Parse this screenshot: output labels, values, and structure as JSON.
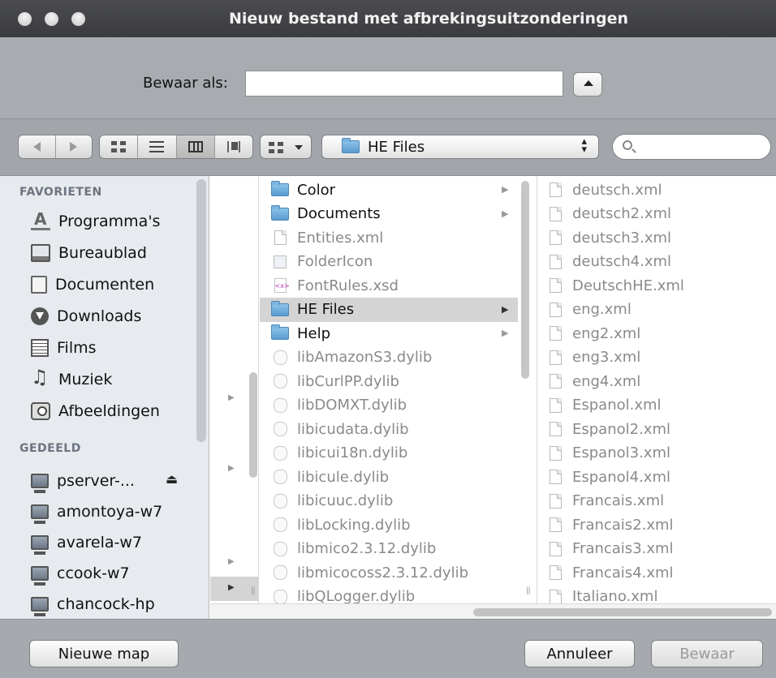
{
  "window": {
    "title": "Nieuw bestand met afbrekingsuitzonderingen"
  },
  "save": {
    "label": "Bewaar als:",
    "value": ""
  },
  "toolbar": {
    "location": "HE Files",
    "search_placeholder": ""
  },
  "sidebar": {
    "favorites_header": "FAVORIETEN",
    "favorites": [
      {
        "label": "Programma's",
        "icon": "applications-icon"
      },
      {
        "label": "Bureaublad",
        "icon": "desktop-icon"
      },
      {
        "label": "Documenten",
        "icon": "documents-icon"
      },
      {
        "label": "Downloads",
        "icon": "downloads-icon"
      },
      {
        "label": "Films",
        "icon": "movies-icon"
      },
      {
        "label": "Muziek",
        "icon": "music-icon"
      },
      {
        "label": "Afbeeldingen",
        "icon": "pictures-icon"
      }
    ],
    "shared_header": "GEDEELD",
    "shared": [
      {
        "label": "pserver-..."
      },
      {
        "label": "amontoya-w7"
      },
      {
        "label": "avarela-w7"
      },
      {
        "label": "ccook-w7"
      },
      {
        "label": "chancock-hp"
      }
    ]
  },
  "column1": {
    "items": [
      {
        "name": "Color",
        "type": "folder"
      },
      {
        "name": "Documents",
        "type": "folder"
      },
      {
        "name": "Entities.xml",
        "type": "file"
      },
      {
        "name": "FolderIcon",
        "type": "icon"
      },
      {
        "name": "FontRules.xsd",
        "type": "xsd"
      },
      {
        "name": "HE Files",
        "type": "folder",
        "selected": true
      },
      {
        "name": "Help",
        "type": "folder"
      },
      {
        "name": "libAmazonS3.dylib",
        "type": "lib"
      },
      {
        "name": "libCurlPP.dylib",
        "type": "lib"
      },
      {
        "name": "libDOMXT.dylib",
        "type": "lib"
      },
      {
        "name": "libicudata.dylib",
        "type": "lib"
      },
      {
        "name": "libicui18n.dylib",
        "type": "lib"
      },
      {
        "name": "libicule.dylib",
        "type": "lib"
      },
      {
        "name": "libicuuc.dylib",
        "type": "lib"
      },
      {
        "name": "libLocking.dylib",
        "type": "lib"
      },
      {
        "name": "libmico2.3.12.dylib",
        "type": "lib"
      },
      {
        "name": "libmicocoss2.3.12.dylib",
        "type": "lib"
      },
      {
        "name": "libQLogger.dylib",
        "type": "lib"
      }
    ]
  },
  "column2": {
    "items": [
      "deutsch.xml",
      "deutsch2.xml",
      "deutsch3.xml",
      "deutsch4.xml",
      "DeutschHE.xml",
      "eng.xml",
      "eng2.xml",
      "eng3.xml",
      "eng4.xml",
      "Espanol.xml",
      "Espanol2.xml",
      "Espanol3.xml",
      "Espanol4.xml",
      "Francais.xml",
      "Francais2.xml",
      "Francais3.xml",
      "Francais4.xml",
      "Italiano.xml"
    ]
  },
  "buttons": {
    "new_folder": "Nieuwe map",
    "cancel": "Annuleer",
    "save": "Bewaar"
  }
}
